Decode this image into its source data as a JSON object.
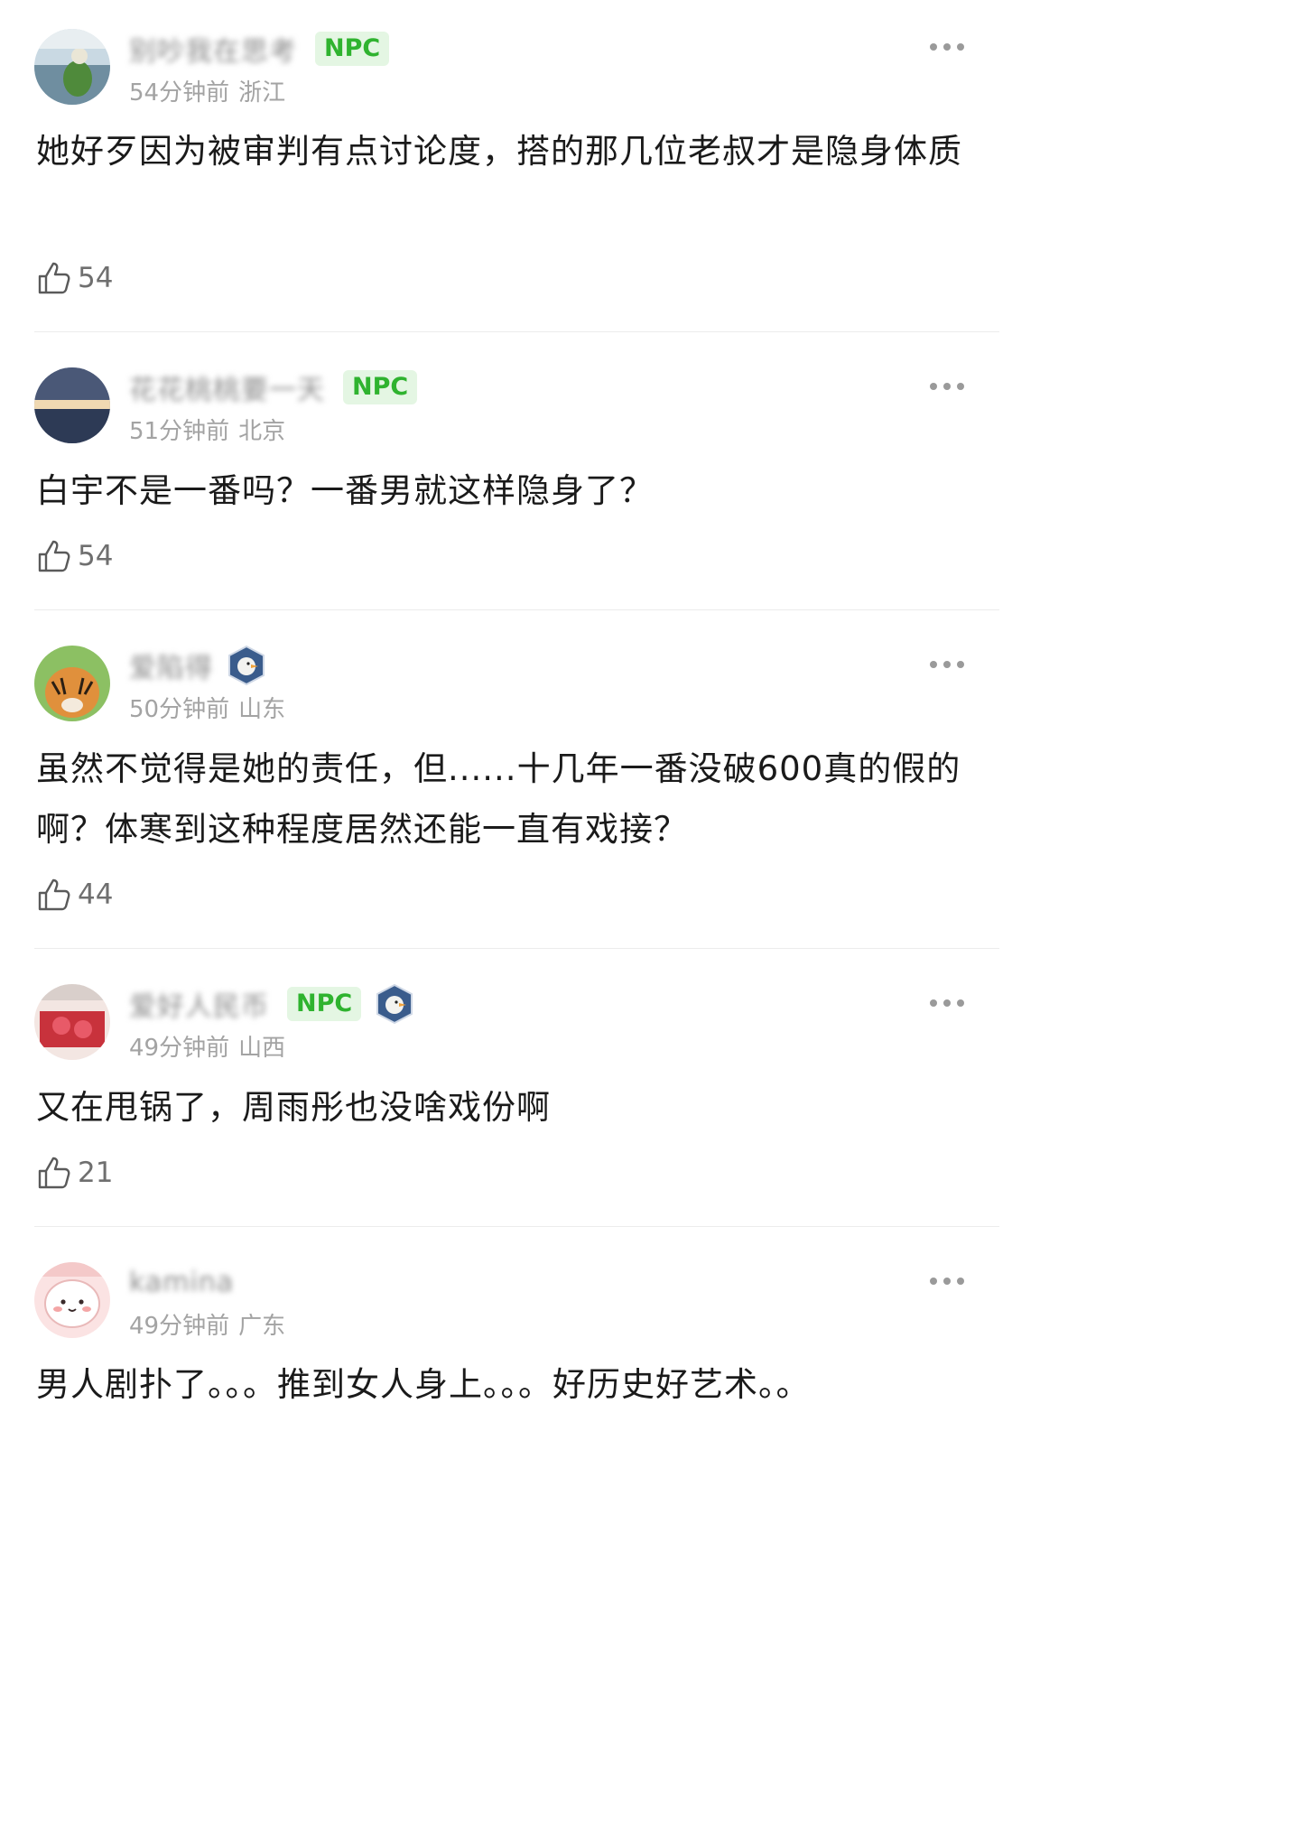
{
  "comments": [
    {
      "username": "别吵我在思考",
      "npc": "NPC",
      "time": "54分钟前",
      "location": "浙江",
      "text": "她好歹因为被审判有点讨论度，搭的那几位老叔才是隐身体质",
      "likes": "54"
    },
    {
      "username": "花花桃桃要一天",
      "npc": "NPC",
      "time": "51分钟前",
      "location": "北京",
      "text": "白宇不是一番吗？一番男就这样隐身了？",
      "likes": "54"
    },
    {
      "username": "爱陷得",
      "time": "50分钟前",
      "location": "山东",
      "text": "虽然不觉得是她的责任，但......十几年一番没破600真的假的啊？体寒到这种程度居然还能一直有戏接？",
      "likes": "44"
    },
    {
      "username": "爱好人民币",
      "npc": "NPC",
      "time": "49分钟前",
      "location": "山西",
      "text": "又在甩锅了，周雨彤也没啥戏份啊",
      "likes": "21"
    },
    {
      "username": "kamina",
      "time": "49分钟前",
      "location": "广东",
      "text": "男人剧扑了。。。推到女人身上。。。好历史好艺术。。"
    }
  ],
  "colors": {
    "npc_text": "#2fb32f",
    "npc_bg": "#e4f6e3",
    "meta_text": "#a3a3a3",
    "body_text": "#1a1a1a"
  },
  "icons": {
    "like": "thumbs-up-outline-icon",
    "more": "more-dots-icon",
    "medal": "duck-medal-icon"
  }
}
